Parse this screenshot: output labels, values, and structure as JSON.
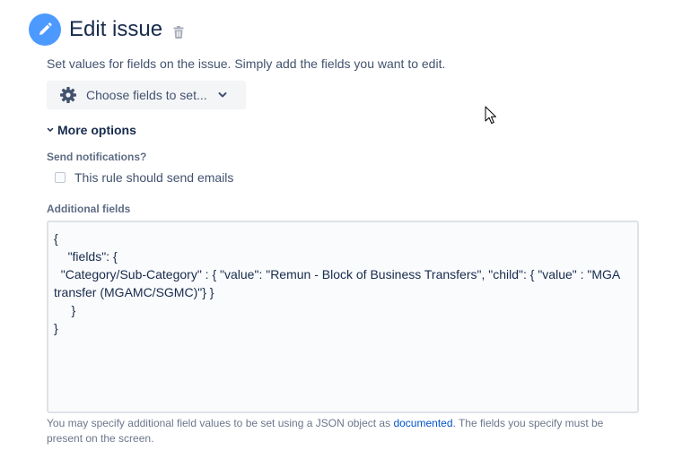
{
  "header": {
    "title": "Edit issue",
    "edit_icon": "pencil-icon",
    "delete_icon": "trash-icon"
  },
  "description": "Set values for fields on the issue. Simply add the fields you want to edit.",
  "choose_fields": {
    "label": "Choose fields to set...",
    "icon": "gear-icon",
    "dropdown_icon": "chevron-down-icon"
  },
  "more_options": {
    "label": "More options",
    "icon": "chevron-down-icon"
  },
  "notifications": {
    "label": "Send notifications?",
    "checkbox_label": "This rule should send emails",
    "checked": false
  },
  "additional_fields": {
    "label": "Additional fields",
    "value": "{\n    \"fields\": {\n  \"Category/Sub-Category\" : { \"value\": \"Remun - Block of Business Transfers\", \"child\": { \"value\" : \"MGA transfer (MGAMC/SGMC)\"} }\n     }\n}"
  },
  "help": {
    "text_before": "You may specify additional field values to be set using a JSON object as ",
    "link_text": "documented",
    "text_after": ". The fields you specify must be present on the screen."
  },
  "colors": {
    "accent_blue": "#4c9aff",
    "link_blue": "#0052cc",
    "text_dark": "#172b4d",
    "text_muted": "#42526e"
  }
}
